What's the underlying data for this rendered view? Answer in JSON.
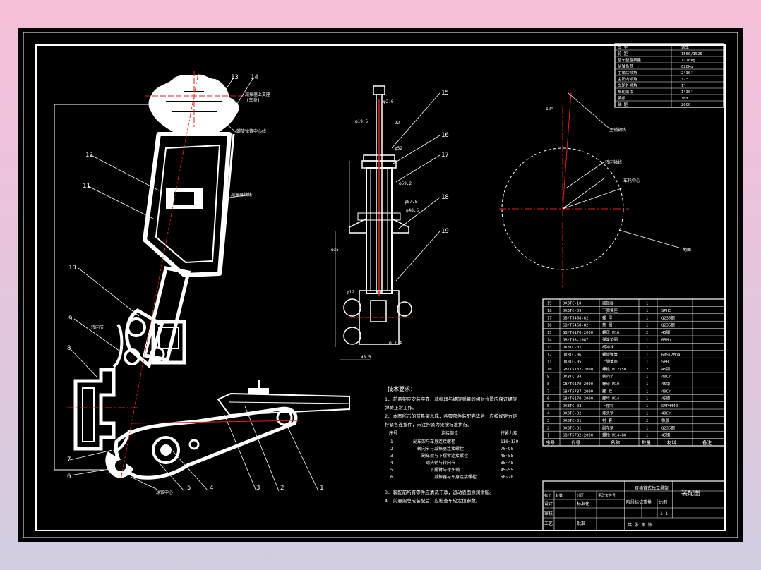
{
  "colors": {
    "background": "#000000",
    "line": "#ffffff",
    "centerline": "#e0201c",
    "page_gradient_top": "#f6bfd8",
    "page_gradient_bottom": "#d2cde0"
  },
  "title_block": {
    "drawing_name": "装配图",
    "scale": "1:1",
    "stage_labels": [
      "阶段标记",
      "重量",
      "比例"
    ],
    "sheet_text": "共  张  第  张",
    "row_labels": [
      "标记",
      "处数",
      "分区",
      "更改文件号",
      "签名",
      "年.月.日"
    ],
    "design": "设计",
    "standard": "标准化",
    "review": "审核",
    "process": "工艺",
    "approve": "批准",
    "center_label": "双横臂式独立悬架"
  },
  "parts_header": {
    "no": "序号",
    "code": "代号",
    "name": "名称",
    "qty": "数量",
    "material": "材料",
    "note": "备注"
  },
  "parts": [
    {
      "no": "19",
      "code": "DX3TC-10",
      "name": "减振器",
      "qty": "1",
      "material": ""
    },
    {
      "no": "18",
      "code": "DX3TC-09",
      "name": "下弹簧座",
      "qty": "1",
      "material": "SPHC"
    },
    {
      "no": "17",
      "code": "GB/T5468-82",
      "name": "螺 母",
      "qty": "1",
      "material": "Q235钢"
    },
    {
      "no": "16",
      "code": "GB/T5468-82",
      "name": "垫 圈",
      "qty": "1",
      "material": "Q235钢"
    },
    {
      "no": "15",
      "code": "GB/T6170-2000",
      "name": "螺母 M16",
      "qty": "2",
      "material": "45钢"
    },
    {
      "no": "14",
      "code": "GB/T93-1987",
      "name": "弹簧垫圈",
      "qty": "1",
      "material": "65Mn"
    },
    {
      "no": "13",
      "code": "DX3TC-07",
      "name": "缓冲块",
      "qty": "1",
      "material": ""
    },
    {
      "no": "12",
      "code": "DX3TC-06",
      "name": "螺旋弹簧",
      "qty": "1",
      "material": "60Si2MnA"
    },
    {
      "no": "11",
      "code": "DX3TC-05",
      "name": "上弹簧座",
      "qty": "1",
      "material": "SPHC"
    },
    {
      "no": "10",
      "code": "GB/T5782-2000",
      "name": "螺栓 M12×50",
      "qty": "2",
      "material": "45钢"
    },
    {
      "no": "9",
      "code": "DX3TC-04",
      "name": "转向节",
      "qty": "1",
      "material": "40Cr"
    },
    {
      "no": "8",
      "code": "GB/T6170-2000",
      "name": "螺母 M10",
      "qty": "1",
      "material": "45钢"
    },
    {
      "no": "7",
      "code": "GB/T5787-2000",
      "name": "螺 栓",
      "qty": "1",
      "material": "40Cr"
    },
    {
      "no": "6",
      "code": "GB/T6170-2000",
      "name": "螺母 M14",
      "qty": "1",
      "material": "45钢"
    },
    {
      "no": "5",
      "code": "DX3TC-03",
      "name": "下摆臂",
      "qty": "1",
      "material": "SAPH440"
    },
    {
      "no": "4",
      "code": "DX3TC-02",
      "name": "球头销",
      "qty": "1",
      "material": "40Cr"
    },
    {
      "no": "3",
      "code": "DX3TC-01",
      "name": "衬 套",
      "qty": "2",
      "material": "橡胶"
    },
    {
      "no": "2",
      "code": "DX3TC-01",
      "name": "副车架",
      "qty": "1",
      "material": "Q235钢"
    },
    {
      "no": "1",
      "code": "GB/T5782-2000",
      "name": "螺栓 M14×80",
      "qty": "1",
      "material": "45钢"
    }
  ],
  "spec_table": [
    {
      "k": "车 型",
      "v": "轿车"
    },
    {
      "k": "轮 距",
      "v": "1560/1520"
    },
    {
      "k": "整车整备质量",
      "v": "1170kg"
    },
    {
      "k": "前轴负荷",
      "v": "620kg"
    },
    {
      "k": "主销后倾角",
      "v": "2°30'"
    },
    {
      "k": "主销内倾角",
      "v": "12°"
    },
    {
      "k": "车轮外倾角",
      "v": "1°"
    },
    {
      "k": "车轮前束",
      "v": "1°30'"
    },
    {
      "k": "偏频",
      "v": "1Hz"
    },
    {
      "k": "轴 距",
      "v": "2600"
    }
  ],
  "tech_requirements": {
    "title": "技术要求：",
    "lines": [
      "1. 前悬架应安装牢靠，减振器与螺旋弹簧的相对位置应保证螺旋",
      "弹簧正常工作。",
      "2. 本图所示的前悬架总成，各零部件装配完毕后，应按规定力矩",
      "拧紧各连接件，未注拧紧力矩按标准执行。"
    ],
    "torque_header": {
      "no": "序号",
      "part": "连接部位",
      "value": "拧紧力矩"
    },
    "torque_rows": [
      {
        "no": "1",
        "part": "副车架与车身连接螺栓",
        "value": "110~130"
      },
      {
        "no": "2",
        "part": "转向节与减振器连接螺栓",
        "value": "70~90"
      },
      {
        "no": "3",
        "part": "副车架与下摆臂连接螺栓",
        "value": "45~55"
      },
      {
        "no": "4",
        "part": "球头销与转向节",
        "value": "35~45"
      },
      {
        "no": "5",
        "part": "下摆臂与球头销",
        "value": "45~55"
      },
      {
        "no": "6",
        "part": "减振器与车身连接螺栓",
        "value": "50~70"
      }
    ],
    "notes": [
      "3. 装配前所有零件应清洗干净，运动表面涂润滑脂。",
      "4. 前悬架总成装配后，应检查车轮定位参数。"
    ]
  },
  "callouts_left": [
    "12",
    "11",
    "10",
    "9",
    "8",
    "7",
    "6"
  ],
  "callouts_bottom": [
    "5",
    "4",
    "3",
    "2",
    "1"
  ],
  "callouts_top": [
    "13",
    "14"
  ],
  "callouts_middle": [
    "15",
    "16",
    "17",
    "18",
    "19"
  ],
  "annotations": {
    "upper_mount": "减振器上支座",
    "upper_mount_sub": "(车身)",
    "spring_axis": "螺旋弹簧中心线",
    "shock_axis": "减振器轴线",
    "knuckle": "转向节",
    "ball_joint": "球铰中心",
    "kingpin": "主销轴线",
    "wheel_center": "车轮中心",
    "ground": "地面",
    "steering_axis": "转向轴线",
    "angle": "12°"
  },
  "dims_middle": [
    "φ2.0",
    "φ52",
    "φ59.2",
    "φ87.5",
    "φ48.6",
    "φ19.5",
    "φ35",
    "48.5",
    "φ12",
    "φ17.4",
    "22"
  ]
}
